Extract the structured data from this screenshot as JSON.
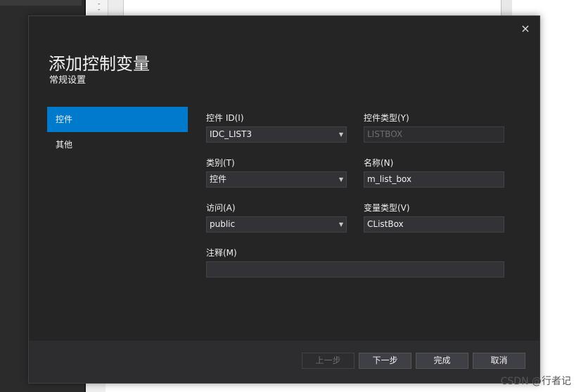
{
  "background": {
    "gutter_text": "-\n-"
  },
  "dialog": {
    "title": "添加控制变量",
    "subtitle": "常规设置",
    "close_icon": "×",
    "nav": [
      {
        "label": "控件",
        "active": true
      },
      {
        "label": "其他",
        "active": false
      }
    ],
    "fields": {
      "control_id": {
        "label": "控件 ID(I)",
        "value": "IDC_LIST3"
      },
      "control_type": {
        "label": "控件类型(Y)",
        "value": "LISTBOX"
      },
      "category": {
        "label": "类别(T)",
        "value": "控件"
      },
      "name": {
        "label": "名称(N)",
        "value": "m_list_box"
      },
      "access": {
        "label": "访问(A)",
        "value": "public"
      },
      "variable_type": {
        "label": "变量类型(V)",
        "value": "CListBox"
      },
      "comment": {
        "label": "注释(M)",
        "value": ""
      }
    },
    "buttons": {
      "prev": "上一步",
      "next": "下一步",
      "finish": "完成",
      "cancel": "取消"
    },
    "colors": {
      "accent": "#007acc",
      "background": "#252526"
    }
  },
  "watermark": "CSDN @行者记"
}
